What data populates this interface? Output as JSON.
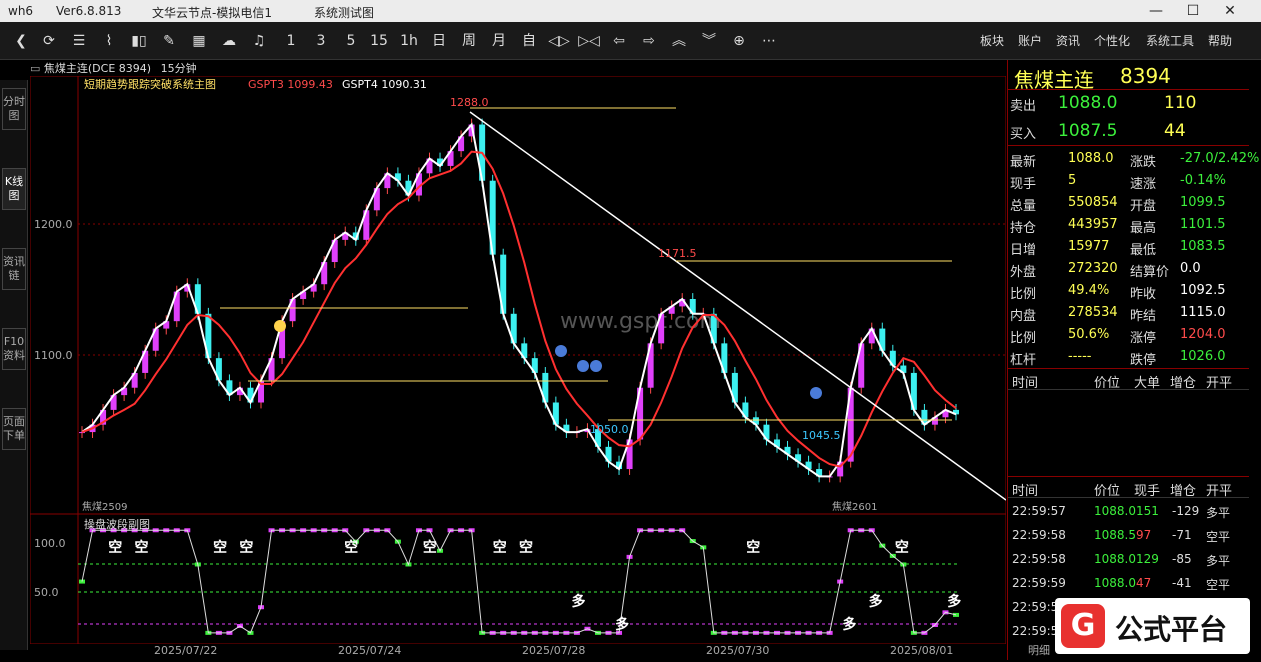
{
  "titlebar": {
    "app": "wh6",
    "version": "Ver6.8.813",
    "server": "文华云节点-模拟电信1",
    "tool": "系统测试图",
    "min": "—",
    "max": "☐",
    "close": "✕"
  },
  "toolbar": {
    "icons": [
      "back-icon",
      "refresh-icon",
      "list-icon",
      "line-chart-icon",
      "candle-icon",
      "draw-icon",
      "grid-icon",
      "cloud-icon",
      "bell-icon"
    ],
    "periods": [
      "1",
      "3",
      "5",
      "15",
      "1h",
      "日",
      "周",
      "月",
      "自"
    ],
    "menu": [
      "板块",
      "账户",
      "资讯",
      "个性化",
      "系统工具",
      "帮助"
    ]
  },
  "sidetabs": [
    "分时图",
    "K线图",
    "资讯链",
    "F10资料",
    "页面下单"
  ],
  "chart_header": {
    "symbol": "焦煤主连(DCE 8394)",
    "period": "15分钟"
  },
  "main_legend": {
    "indicator": "短期趋势跟踪突破系统主图",
    "g3": "GSPT3 1099.43",
    "g4": "GSPT4 1090.31"
  },
  "sub_legend": {
    "indicator": "操盘波段副图"
  },
  "watermark": "www.gspt.com",
  "chart_data": {
    "type": "candlestick",
    "yaxis_main": {
      "ticks": [
        "1200.0",
        "1100.0"
      ],
      "ylim": [
        1030,
        1310
      ]
    },
    "yaxis_sub": {
      "ticks": [
        "100.0",
        "50.0"
      ],
      "ylim": [
        -5,
        110
      ]
    },
    "annotations": {
      "high": "1288.0",
      "low1": "1050.0",
      "mid": "1171.5",
      "low2": "1045.5"
    },
    "contract_labels": {
      "left": "焦煤2509",
      "right": "焦煤2601"
    },
    "xlabels": [
      "2025/07/22",
      "2025/07/24",
      "2025/07/28",
      "2025/07/30",
      "2025/08/01"
    ],
    "signals": [
      {
        "x": 0.03,
        "text": "空",
        "kind": "short"
      },
      {
        "x": 0.06,
        "text": "空",
        "kind": "short"
      },
      {
        "x": 0.15,
        "text": "空",
        "kind": "short"
      },
      {
        "x": 0.18,
        "text": "空",
        "kind": "short"
      },
      {
        "x": 0.3,
        "text": "空",
        "kind": "short"
      },
      {
        "x": 0.39,
        "text": "空",
        "kind": "short"
      },
      {
        "x": 0.47,
        "text": "空",
        "kind": "short"
      },
      {
        "x": 0.5,
        "text": "空",
        "kind": "short"
      },
      {
        "x": 0.56,
        "text": "多",
        "kind": "long"
      },
      {
        "x": 0.61,
        "text": "多",
        "kind": "long"
      },
      {
        "x": 0.76,
        "text": "空",
        "kind": "short"
      },
      {
        "x": 0.87,
        "text": "多",
        "kind": "long"
      },
      {
        "x": 0.9,
        "text": "多",
        "kind": "long"
      },
      {
        "x": 0.93,
        "text": "空",
        "kind": "short"
      },
      {
        "x": 0.99,
        "text": "多",
        "kind": "long"
      }
    ],
    "path_points": [
      1080,
      1085,
      1095,
      1105,
      1110,
      1120,
      1135,
      1150,
      1155,
      1175,
      1180,
      1160,
      1130,
      1115,
      1105,
      1110,
      1100,
      1115,
      1130,
      1155,
      1170,
      1175,
      1180,
      1195,
      1210,
      1215,
      1210,
      1230,
      1245,
      1255,
      1250,
      1240,
      1255,
      1265,
      1260,
      1270,
      1280,
      1288,
      1250,
      1200,
      1160,
      1140,
      1130,
      1120,
      1100,
      1085,
      1080,
      1080,
      1082,
      1070,
      1060,
      1055,
      1075,
      1110,
      1140,
      1160,
      1165,
      1170,
      1160,
      1160,
      1140,
      1120,
      1100,
      1090,
      1085,
      1075,
      1070,
      1065,
      1060,
      1055,
      1050,
      1050,
      1060,
      1110,
      1140,
      1150,
      1135,
      1125,
      1120,
      1095,
      1085,
      1090,
      1095,
      1092
    ]
  },
  "quote": {
    "title": "焦煤主连",
    "code": "8394",
    "sell": {
      "label": "卖出",
      "price": "1088.0",
      "vol": "110"
    },
    "buy": {
      "label": "买入",
      "price": "1087.5",
      "vol": "44"
    },
    "fields": [
      [
        "最新",
        "1088.0",
        "涨跌",
        "-27.0/2.42%"
      ],
      [
        "现手",
        "5",
        "速涨",
        "-0.14%"
      ],
      [
        "总量",
        "550854",
        "开盘",
        "1099.5"
      ],
      [
        "持仓",
        "443957",
        "最高",
        "1101.5"
      ],
      [
        "日增",
        "15977",
        "最低",
        "1083.5"
      ],
      [
        "外盘",
        "272320",
        "结算价",
        "0.0"
      ],
      [
        "比例",
        "49.4%",
        "昨收",
        "1092.5"
      ],
      [
        "内盘",
        "278534",
        "昨结",
        "1115.0"
      ],
      [
        "比例",
        "50.6%",
        "涨停",
        "1204.0"
      ],
      [
        "杠杆",
        "-----",
        "跌停",
        "1026.0"
      ]
    ],
    "colors": {
      "value_left": [
        "#ffff55",
        "#ffff55",
        "#ffff55",
        "#ffff55",
        "#ffff55",
        "#ffff55",
        "#ffff55",
        "#ffff55",
        "#ffff55",
        "#ffff55"
      ],
      "value_right": [
        "#3cf03c",
        "#3cf03c",
        "#3cf03c",
        "#3cf03c",
        "#3cf03c",
        "#ffffff",
        "#ffffff",
        "#ffffff",
        "#ff4b4b",
        "#3cf03c"
      ]
    },
    "hdr1": [
      "时间",
      "价位",
      "大单",
      "增仓",
      "开平"
    ],
    "hdr2": [
      "时间",
      "价位",
      "现手",
      "增仓",
      "开平"
    ],
    "ticks": [
      [
        "22:59:57",
        "1088.0",
        "151",
        "-129",
        "多平"
      ],
      [
        "22:59:58",
        "1088.5",
        "97",
        "-71",
        "空平"
      ],
      [
        "22:59:58",
        "1088.0",
        "129",
        "-85",
        "多平"
      ],
      [
        "22:59:59",
        "1088.0",
        "47",
        "-41",
        "空平"
      ],
      [
        "22:59:5",
        "",
        " ",
        "",
        ""
      ],
      [
        "22:59:5",
        "",
        "",
        "",
        ""
      ]
    ],
    "bottom": "明细"
  },
  "logo": {
    "brand": "公式平台"
  }
}
